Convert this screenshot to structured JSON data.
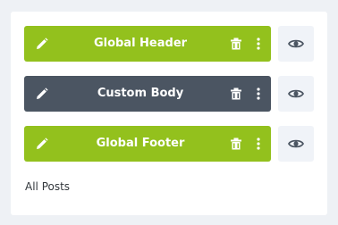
{
  "layouts": [
    {
      "label": "Global Header",
      "color": "#93c11d",
      "icons": [
        "edit-icon",
        "trash-icon",
        "more-vertical-icon",
        "eye-icon"
      ]
    },
    {
      "label": "Custom Body",
      "color": "#4b5562",
      "icons": [
        "edit-icon",
        "trash-icon",
        "more-vertical-icon",
        "eye-icon"
      ]
    },
    {
      "label": "Global Footer",
      "color": "#93c11d",
      "icons": [
        "edit-icon",
        "trash-icon",
        "more-vertical-icon",
        "eye-icon"
      ]
    }
  ],
  "assignment_label": "All Posts"
}
